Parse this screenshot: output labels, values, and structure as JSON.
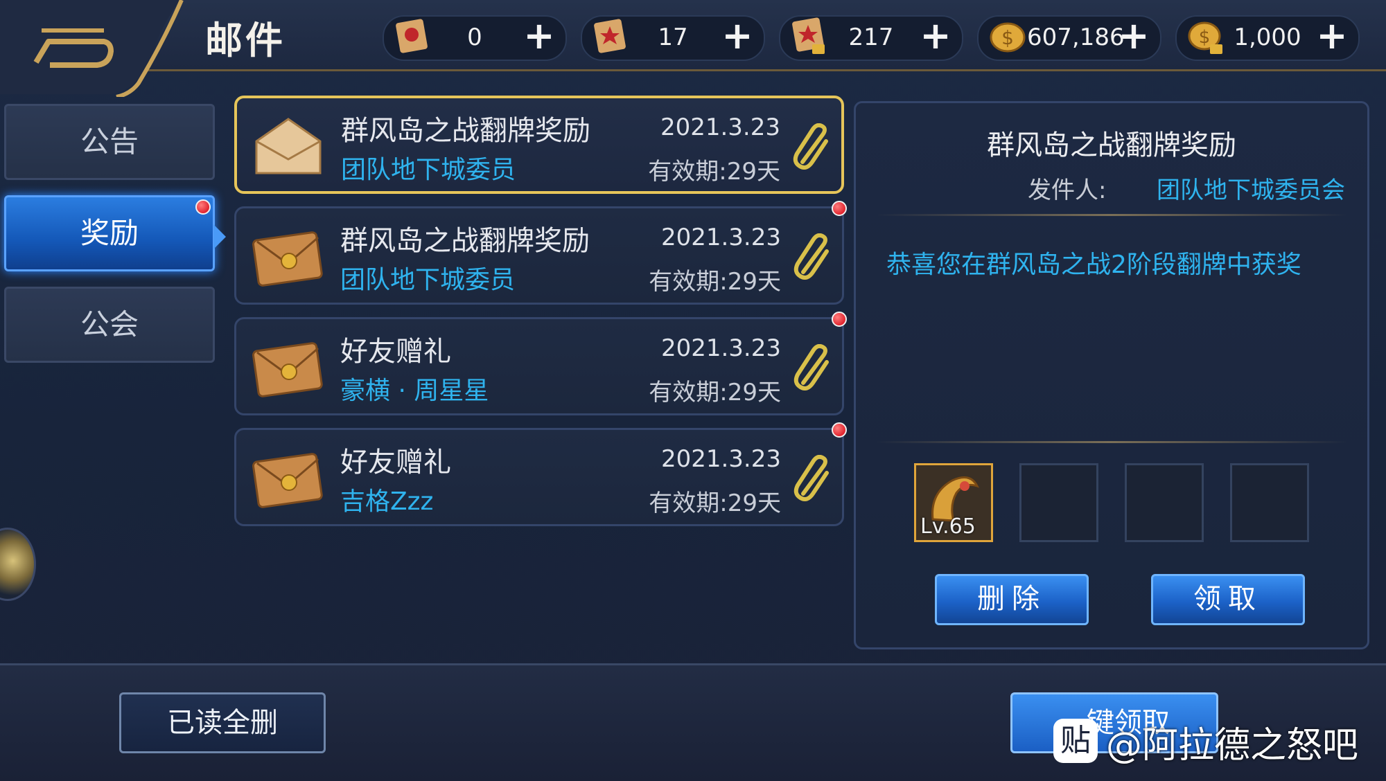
{
  "header": {
    "title": "邮件",
    "currencies": [
      {
        "icon": "red-scroll-icon",
        "value": "0"
      },
      {
        "icon": "red-star-scroll-icon",
        "value": "17"
      },
      {
        "icon": "locked-scroll-icon",
        "value": "217"
      },
      {
        "icon": "gold-coin-icon",
        "value": "607,186"
      },
      {
        "icon": "locked-gold-coin-icon",
        "value": "1,000"
      }
    ]
  },
  "tabs": [
    {
      "label": "公告",
      "active": false,
      "badge": false
    },
    {
      "label": "奖励",
      "active": true,
      "badge": true
    },
    {
      "label": "公会",
      "active": false,
      "badge": false
    }
  ],
  "mails": [
    {
      "title": "群风岛之战翻牌奖励",
      "sender": "团队地下城委员",
      "date": "2021.3.23",
      "expiry": "有效期:29天",
      "selected": true,
      "unread": false
    },
    {
      "title": "群风岛之战翻牌奖励",
      "sender": "团队地下城委员",
      "date": "2021.3.23",
      "expiry": "有效期:29天",
      "selected": false,
      "unread": true
    },
    {
      "title": "好友赠礼",
      "sender": "豪横 · 周星星",
      "date": "2021.3.23",
      "expiry": "有效期:29天",
      "selected": false,
      "unread": true
    },
    {
      "title": "好友赠礼",
      "sender": "吉格Zzz",
      "date": "2021.3.23",
      "expiry": "有效期:29天",
      "selected": false,
      "unread": true
    }
  ],
  "detail": {
    "title": "群风岛之战翻牌奖励",
    "sender_label": "发件人:",
    "sender": "团队地下城委员会",
    "body": "恭喜您在群风岛之战2阶段翻牌中获奖",
    "attachments": [
      {
        "icon": "golden-horn-item-icon",
        "level": "Lv.65"
      },
      null,
      null,
      null
    ],
    "delete_label": "删除",
    "claim_label": "领取"
  },
  "footer": {
    "delete_read_label": "已读全删",
    "claim_all_label": "一键领取"
  },
  "watermark": {
    "icon_text": "贴",
    "text": "@阿拉德之怒吧"
  },
  "colors": {
    "accent_blue": "#2fb3ee",
    "selected_border": "#e6c55a",
    "badge_red": "#d4000f"
  }
}
